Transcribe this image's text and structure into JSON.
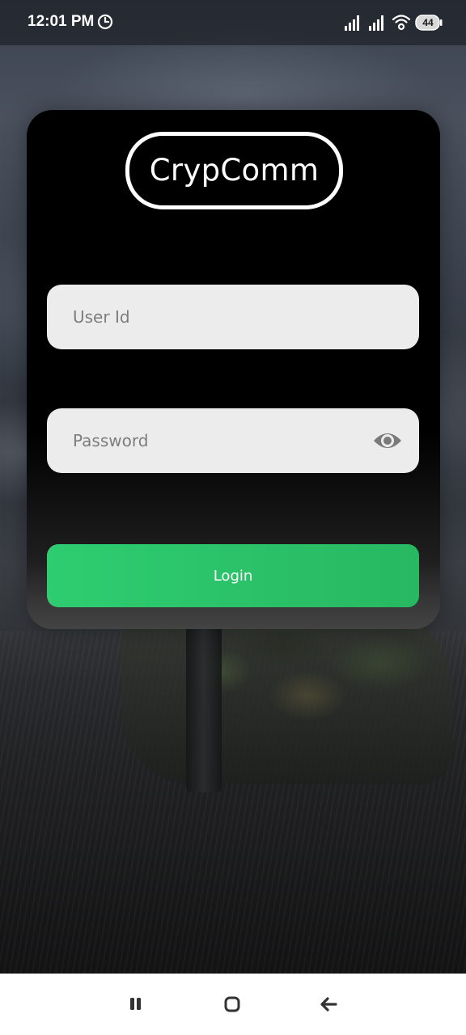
{
  "status_bar": {
    "time": "12:01 PM",
    "battery": "44",
    "icons": [
      "clock-icon",
      "signal-icon",
      "signal-icon",
      "wifi-icon",
      "battery-icon"
    ]
  },
  "login": {
    "logo_text": "CrypComm",
    "user_id_placeholder": "User Id",
    "user_id_value": "",
    "password_placeholder": "Password",
    "password_value": "",
    "password_toggle_icon": "eye-icon",
    "login_label": "Login"
  },
  "nav_bar": {
    "icons": [
      "recents-icon",
      "home-icon",
      "back-icon"
    ]
  },
  "colors": {
    "card": "#000000",
    "field": "#ececec",
    "login_button": "#2ecd70",
    "text_on_button": "#ffffff",
    "nav_bar": "#ffffff"
  }
}
